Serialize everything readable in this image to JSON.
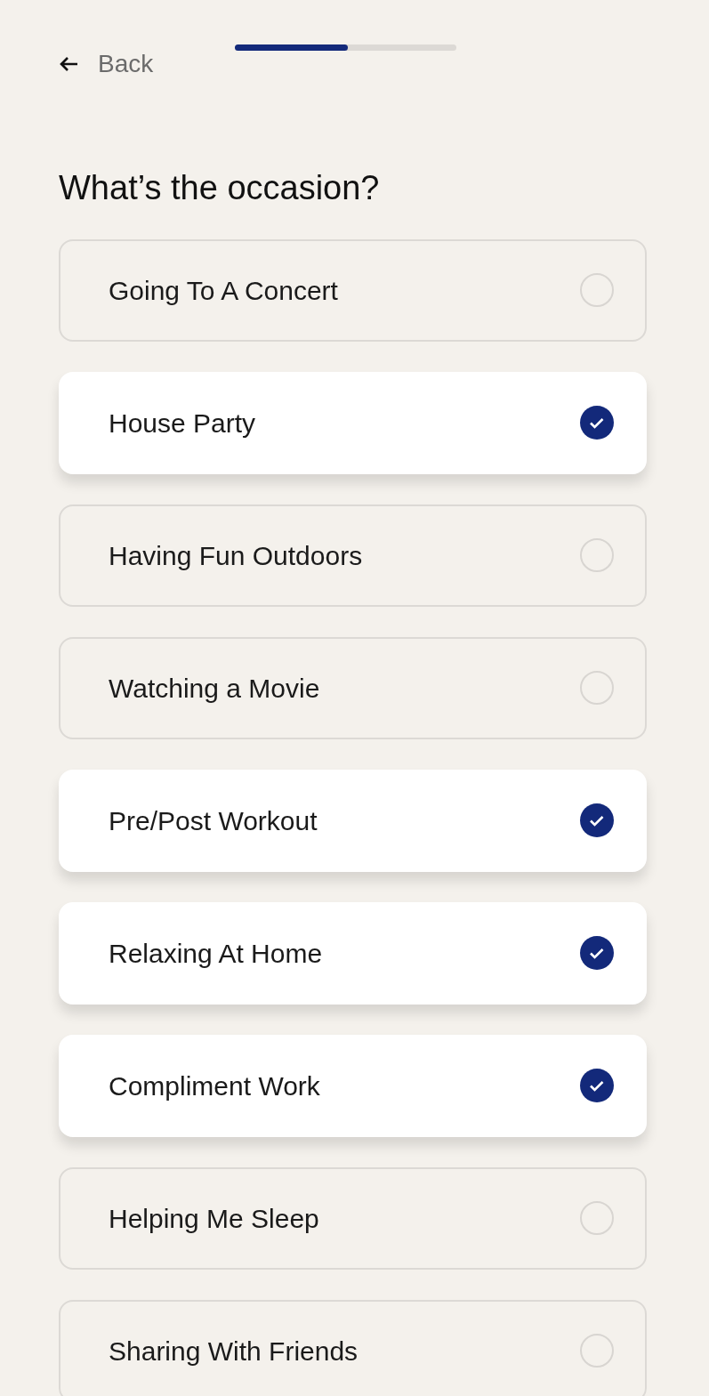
{
  "header": {
    "back_label": "Back",
    "progress": {
      "level": 0.51
    }
  },
  "title": "What’s the occasion?",
  "options": [
    {
      "label": "Going To A Concert",
      "selected": false
    },
    {
      "label": "House Party",
      "selected": true
    },
    {
      "label": "Having Fun Outdoors",
      "selected": false
    },
    {
      "label": "Watching a Movie",
      "selected": false
    },
    {
      "label": "Pre/Post Workout",
      "selected": true
    },
    {
      "label": "Relaxing At Home",
      "selected": true
    },
    {
      "label": "Compliment Work",
      "selected": true
    },
    {
      "label": "Helping Me Sleep",
      "selected": false
    },
    {
      "label": "Sharing With Friends",
      "selected": false
    }
  ]
}
